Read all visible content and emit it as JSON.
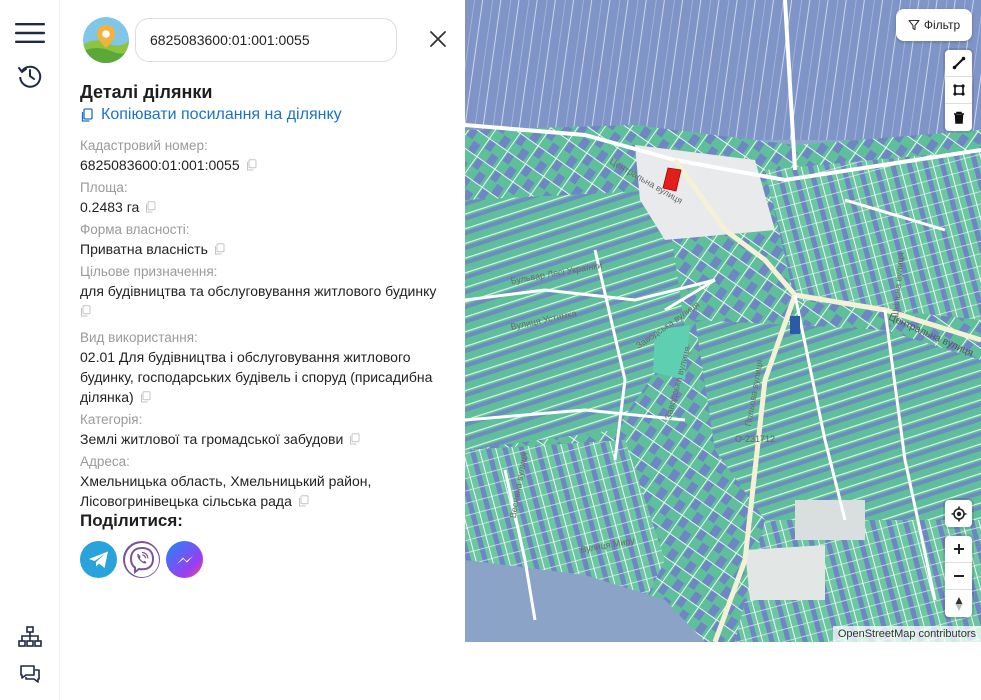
{
  "search": {
    "value": "6825083600:01:001:0055"
  },
  "details": {
    "title": "Деталі ділянки",
    "copy_link_label": "Копіювати посилання на ділянку"
  },
  "fields": [
    {
      "label": "Кадастровий номер:",
      "value": "6825083600:01:001:0055"
    },
    {
      "label": "Площа:",
      "value": "0.2483 га"
    },
    {
      "label": "Форма власності:",
      "value": "Приватна власність"
    },
    {
      "label": "Цільове призначення:",
      "value": "для будівництва та обслуговування житлового будинку"
    },
    {
      "label": "Вид використання:",
      "value": "02.01 Для будівництва і обслуговування житлового будинку, господарських будівель і споруд (присадибна ділянка)"
    },
    {
      "label": "Категорія:",
      "value": "Землі житлової та громадської забудови"
    },
    {
      "label": "Адреса:",
      "value": "Хмельницька область, Хмельницький район, Лісовогринівецька сільська рада"
    }
  ],
  "share": {
    "title": "Поділитися:",
    "buttons": [
      {
        "name": "telegram",
        "icon": "telegram-icon",
        "color": "#2aa3dd"
      },
      {
        "name": "viber",
        "icon": "viber-icon",
        "color": "#7b519d"
      },
      {
        "name": "messenger",
        "icon": "messenger-icon",
        "color": "#7d4cf2"
      }
    ]
  },
  "map": {
    "filter_label": "Фільтр",
    "attribution": "OpenStreetMap contributors",
    "street_labels": [
      "Центральна вулиця",
      "Центральна вулиця",
      "Бульвар Лесі Українки",
      "Вулиця Устимка",
      "Заводська вулиця",
      "Заводська вулиця",
      "Весняна вулиця",
      "Вулиця Миру",
      "Польова вулиця",
      "О-231712",
      "Шкільна вулиця"
    ],
    "colors": {
      "parcel_green": "#5fbf9a",
      "parcel_blue": "#6f86c4",
      "selected": "#e0211b",
      "water": "#8aa4c8",
      "road": "#ffffff"
    }
  },
  "sidebar": {
    "icons": [
      "menu-icon",
      "history-icon",
      "sitemap-icon",
      "chat-icon"
    ]
  }
}
